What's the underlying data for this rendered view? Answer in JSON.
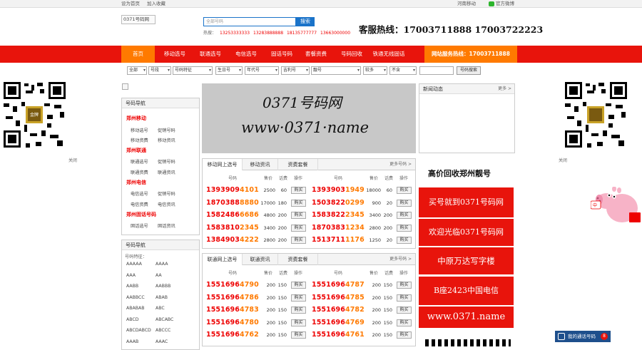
{
  "topbar": {
    "items": [
      "设为首页",
      "加入收藏",
      "河南移动",
      "官方微博"
    ]
  },
  "header": {
    "logo_alt": "0371号码网",
    "search_placeholder": "全部号码",
    "search_button": "搜索",
    "hot_label": "热搜：",
    "hot_numbers": [
      "13253333333",
      "13283888888",
      "18135777777",
      "13663000000"
    ],
    "hotline": "客服热线：17003711888 17003722223"
  },
  "nav": {
    "items": [
      "首页",
      "移动选号",
      "联通选号",
      "电信选号",
      "固话号码",
      "套餐资费",
      "号码回收",
      "铁通无线固话"
    ],
    "site_hotline": "网站服务热线：17003711888"
  },
  "filters": {
    "selects": [
      "全部",
      "号段",
      "号码特征",
      "生日号",
      "年代号",
      "吉利号",
      "靓号",
      "较多",
      "不含"
    ],
    "search_button": "号码搜索"
  },
  "side_qr": {
    "left_label": "关闭",
    "right_label": "关闭",
    "badge": "金牌"
  },
  "left_sidebar": {
    "nav_title": "号码导航",
    "sections": [
      {
        "title": "郑州移动",
        "links": [
          "移动选号",
          "促销号码",
          "移动资费",
          "移动资讯"
        ]
      },
      {
        "title": "郑州联通",
        "links": [
          "联通选号",
          "促销号码",
          "联通资费",
          "联通资讯"
        ]
      },
      {
        "title": "郑州电信",
        "links": [
          "电信选号",
          "促销号码",
          "电信资费",
          "电信资讯"
        ]
      },
      {
        "title": "郑州固话号码",
        "links": [
          "固话选号",
          "固话资讯"
        ]
      }
    ],
    "guide_title": "号码导航",
    "feature_label": "号码特征：",
    "features": [
      [
        "AAAAA",
        "AAAA"
      ],
      [
        "AAA",
        "AA"
      ],
      [
        "AABB",
        "AABBB"
      ],
      [
        "AABBCC",
        "ABAB"
      ],
      [
        "ABABAB",
        "ABC"
      ],
      [
        "ABCD",
        "ABCABC"
      ],
      [
        "ABCDABCD",
        "ABCCC"
      ],
      [
        "AAAB",
        "AAAC"
      ]
    ]
  },
  "banner": {
    "line1": "0371号码网",
    "line2": "www·0371·name"
  },
  "mobile_panel": {
    "tabs": [
      "移动网上选号",
      "移动资讯",
      "资费套餐"
    ],
    "more": "更多号码 >",
    "headers": [
      "号码",
      "售价",
      "话费",
      "操作"
    ],
    "buy": "购买",
    "rows": [
      [
        {
          "pre": "1393909",
          "hl": "4101",
          "price": "2500",
          "fee": "60"
        },
        {
          "pre": "1393903",
          "hl": "1949",
          "price": "18000",
          "fee": "60"
        }
      ],
      [
        {
          "pre": "1870388",
          "hl": "8880",
          "price": "17000",
          "fee": "180"
        },
        {
          "pre": "1503822",
          "hl": "0299",
          "price": "900",
          "fee": "20"
        }
      ],
      [
        {
          "pre": "1582486",
          "hl": "6686",
          "price": "4800",
          "fee": "200"
        },
        {
          "pre": "1583822",
          "hl": "2345",
          "price": "3400",
          "fee": "200"
        }
      ],
      [
        {
          "pre": "1583810",
          "hl": "2345",
          "price": "3400",
          "fee": "200"
        },
        {
          "pre": "1870383",
          "hl": "1234",
          "price": "2800",
          "fee": "200"
        }
      ],
      [
        {
          "pre": "1384903",
          "hl": "4222",
          "price": "2800",
          "fee": "200"
        },
        {
          "pre": "1513711",
          "hl": "1176",
          "price": "1250",
          "fee": "20"
        }
      ]
    ]
  },
  "unicom_panel": {
    "tabs": [
      "联通网上选号",
      "联通资讯",
      "资费套餐"
    ],
    "more": "更多号码 >",
    "headers": [
      "号码",
      "售价",
      "话费",
      "操作"
    ],
    "buy": "购买",
    "rows": [
      [
        {
          "pre": "1551696",
          "hl": "4790",
          "price": "200",
          "fee": "150"
        },
        {
          "pre": "1551696",
          "hl": "4787",
          "price": "200",
          "fee": "150"
        }
      ],
      [
        {
          "pre": "1551696",
          "hl": "4786",
          "price": "200",
          "fee": "150"
        },
        {
          "pre": "1551696",
          "hl": "4785",
          "price": "200",
          "fee": "150"
        }
      ],
      [
        {
          "pre": "1551696",
          "hl": "4783",
          "price": "200",
          "fee": "150"
        },
        {
          "pre": "1551696",
          "hl": "4782",
          "price": "200",
          "fee": "150"
        }
      ],
      [
        {
          "pre": "1551696",
          "hl": "4780",
          "price": "200",
          "fee": "150"
        },
        {
          "pre": "1551696",
          "hl": "4769",
          "price": "200",
          "fee": "150"
        }
      ],
      [
        {
          "pre": "1551696",
          "hl": "4762",
          "price": "200",
          "fee": "150"
        },
        {
          "pre": "1551696",
          "hl": "4761",
          "price": "200",
          "fee": "150"
        }
      ]
    ]
  },
  "right_col": {
    "news_title": "新闻动态",
    "news_more": "更多 >",
    "recycle": "高价回收郑州靓号",
    "ads": [
      "买号就到0371号码网",
      "欢迎光临0371号码网",
      "中原万达写字楼",
      "B座2423中国电信",
      "www.0371.name"
    ]
  },
  "float": {
    "chat_button": "我的通话号码",
    "chat_badge": "8"
  },
  "colors": {
    "nav_red": "#e8140c",
    "nav_orange": "#ff7a00",
    "number_red": "#e00",
    "number_orange": "#ff7a00"
  }
}
